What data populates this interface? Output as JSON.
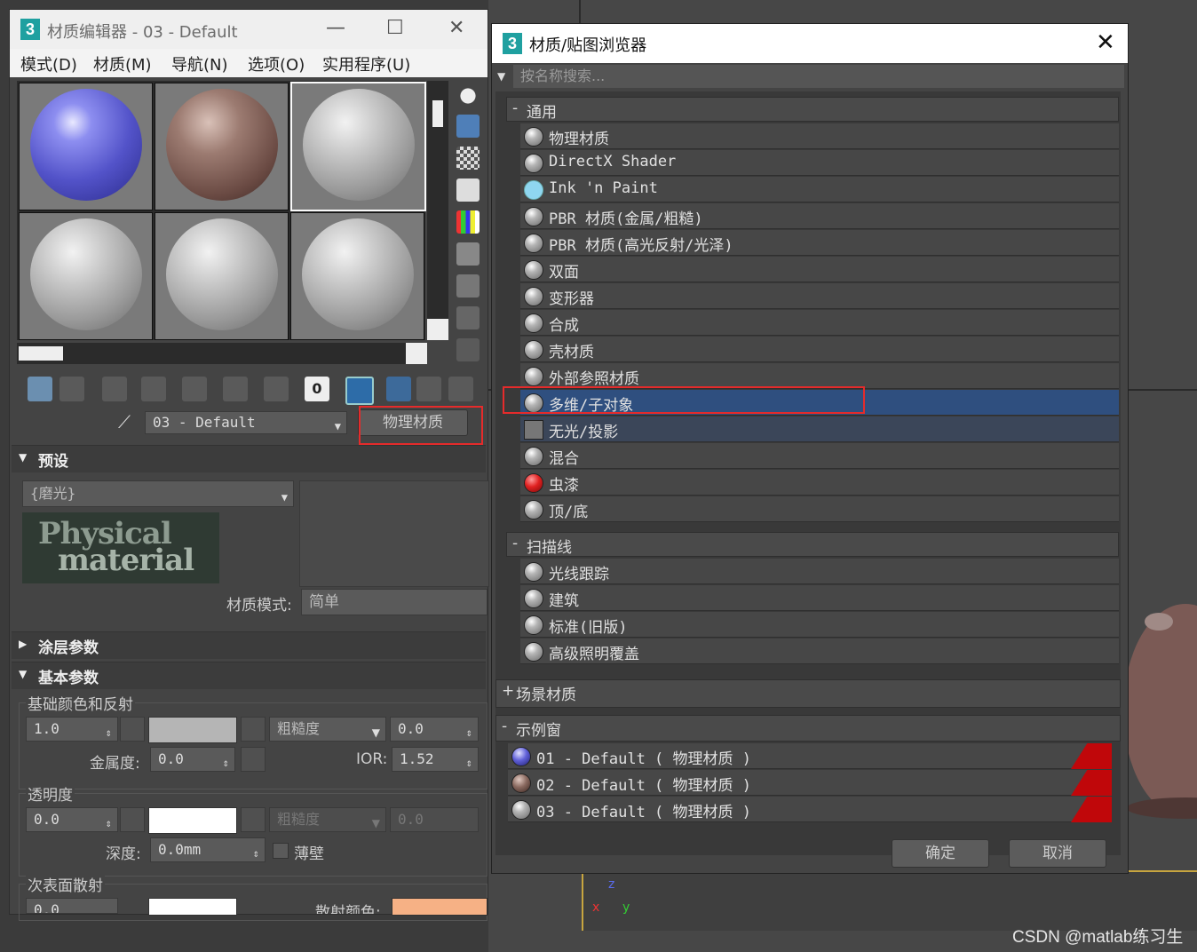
{
  "material_editor": {
    "title": "材质编辑器 - 03 - Default",
    "logo": "3",
    "menu": [
      "模式(D)",
      "材质(M)",
      "导航(N)",
      "选项(O)",
      "实用程序(U)"
    ],
    "material_name": "03 - Default",
    "material_type_button": "物理材质",
    "toolbar_value": "0",
    "presets": {
      "header": "预设",
      "preset_value": "{磨光}",
      "logo_text_1": "Physical",
      "logo_text_2": "material",
      "mode_label": "材质模式:",
      "mode_value": "简单"
    },
    "rollups": {
      "coating": "涂层参数",
      "basic": "基本参数"
    },
    "basic": {
      "base_group": "基础颜色和反射",
      "base_weight": "1.0",
      "roughness_label": "粗糙度",
      "roughness_value": "0.0",
      "metalness_label": "金属度:",
      "metalness_value": "0.0",
      "ior_label": "IOR:",
      "ior_value": "1.52",
      "transparency_group": "透明度",
      "transparency_value": "0.0",
      "trans_roughness_label": "粗糙度",
      "trans_roughness_value": "0.0",
      "depth_label": "深度:",
      "depth_value": "0.0mm",
      "thin_wall_label": "薄壁",
      "sss_group": "次表面散射",
      "sss_value": "0.0",
      "scatter_color_label": "散射颜色:"
    },
    "colors": {
      "base_swatch": "#b5b5b5",
      "trans_swatch": "#ffffff",
      "sss_swatch": "#ffffff",
      "scatter_swatch": "#f6b185"
    }
  },
  "browser": {
    "title": "材质/贴图浏览器",
    "logo": "3",
    "search_placeholder": "按名称搜索...",
    "categories": {
      "general": "通用",
      "scanline": "扫描线",
      "scene": "场景材质",
      "sample_slots": "示例窗"
    },
    "general_items": [
      "物理材质",
      "DirectX Shader",
      "Ink 'n Paint",
      "PBR 材质(金属/粗糙)",
      "PBR 材质(高光反射/光泽)",
      "双面",
      "变形器",
      "合成",
      "壳材质",
      "外部参照材质",
      "多维/子对象",
      "无光/投影",
      "混合",
      "虫漆",
      "顶/底"
    ],
    "scanline_items": [
      "光线跟踪",
      "建筑",
      "标准(旧版)",
      "高级照明覆盖"
    ],
    "sample_items": [
      "01 - Default  ( 物理材质 )",
      "02 - Default  ( 物理材质 )",
      "03 - Default  ( 物理材质 )"
    ],
    "ok_button": "确定",
    "cancel_button": "取消"
  },
  "viewport": {
    "axis_z": "z",
    "axis_x": "x",
    "axis_y": "y"
  },
  "watermark": "CSDN @matlab练习生"
}
